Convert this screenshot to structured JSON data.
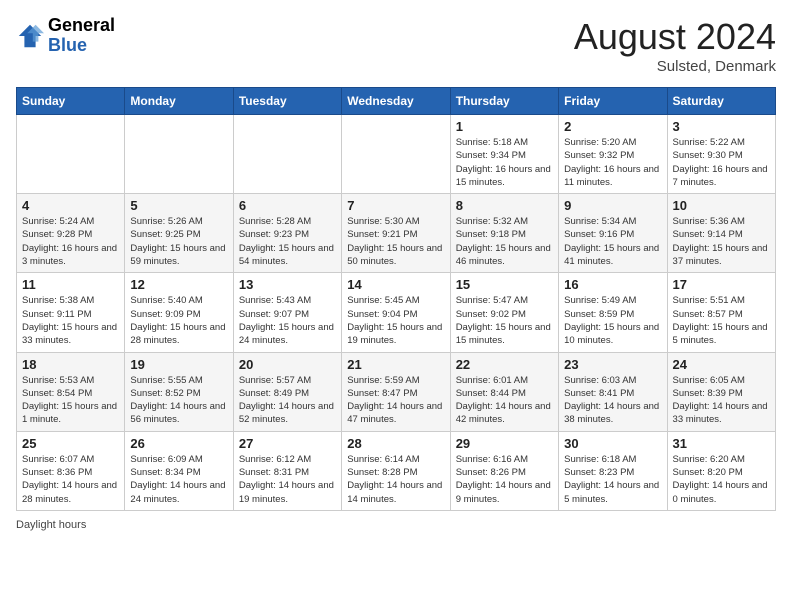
{
  "header": {
    "logo_general": "General",
    "logo_blue": "Blue",
    "month_title": "August 2024",
    "subtitle": "Sulsted, Denmark"
  },
  "days_of_week": [
    "Sunday",
    "Monday",
    "Tuesday",
    "Wednesday",
    "Thursday",
    "Friday",
    "Saturday"
  ],
  "weeks": [
    [
      {
        "day": "",
        "info": ""
      },
      {
        "day": "",
        "info": ""
      },
      {
        "day": "",
        "info": ""
      },
      {
        "day": "",
        "info": ""
      },
      {
        "day": "1",
        "info": "Sunrise: 5:18 AM\nSunset: 9:34 PM\nDaylight: 16 hours and 15 minutes."
      },
      {
        "day": "2",
        "info": "Sunrise: 5:20 AM\nSunset: 9:32 PM\nDaylight: 16 hours and 11 minutes."
      },
      {
        "day": "3",
        "info": "Sunrise: 5:22 AM\nSunset: 9:30 PM\nDaylight: 16 hours and 7 minutes."
      }
    ],
    [
      {
        "day": "4",
        "info": "Sunrise: 5:24 AM\nSunset: 9:28 PM\nDaylight: 16 hours and 3 minutes."
      },
      {
        "day": "5",
        "info": "Sunrise: 5:26 AM\nSunset: 9:25 PM\nDaylight: 15 hours and 59 minutes."
      },
      {
        "day": "6",
        "info": "Sunrise: 5:28 AM\nSunset: 9:23 PM\nDaylight: 15 hours and 54 minutes."
      },
      {
        "day": "7",
        "info": "Sunrise: 5:30 AM\nSunset: 9:21 PM\nDaylight: 15 hours and 50 minutes."
      },
      {
        "day": "8",
        "info": "Sunrise: 5:32 AM\nSunset: 9:18 PM\nDaylight: 15 hours and 46 minutes."
      },
      {
        "day": "9",
        "info": "Sunrise: 5:34 AM\nSunset: 9:16 PM\nDaylight: 15 hours and 41 minutes."
      },
      {
        "day": "10",
        "info": "Sunrise: 5:36 AM\nSunset: 9:14 PM\nDaylight: 15 hours and 37 minutes."
      }
    ],
    [
      {
        "day": "11",
        "info": "Sunrise: 5:38 AM\nSunset: 9:11 PM\nDaylight: 15 hours and 33 minutes."
      },
      {
        "day": "12",
        "info": "Sunrise: 5:40 AM\nSunset: 9:09 PM\nDaylight: 15 hours and 28 minutes."
      },
      {
        "day": "13",
        "info": "Sunrise: 5:43 AM\nSunset: 9:07 PM\nDaylight: 15 hours and 24 minutes."
      },
      {
        "day": "14",
        "info": "Sunrise: 5:45 AM\nSunset: 9:04 PM\nDaylight: 15 hours and 19 minutes."
      },
      {
        "day": "15",
        "info": "Sunrise: 5:47 AM\nSunset: 9:02 PM\nDaylight: 15 hours and 15 minutes."
      },
      {
        "day": "16",
        "info": "Sunrise: 5:49 AM\nSunset: 8:59 PM\nDaylight: 15 hours and 10 minutes."
      },
      {
        "day": "17",
        "info": "Sunrise: 5:51 AM\nSunset: 8:57 PM\nDaylight: 15 hours and 5 minutes."
      }
    ],
    [
      {
        "day": "18",
        "info": "Sunrise: 5:53 AM\nSunset: 8:54 PM\nDaylight: 15 hours and 1 minute."
      },
      {
        "day": "19",
        "info": "Sunrise: 5:55 AM\nSunset: 8:52 PM\nDaylight: 14 hours and 56 minutes."
      },
      {
        "day": "20",
        "info": "Sunrise: 5:57 AM\nSunset: 8:49 PM\nDaylight: 14 hours and 52 minutes."
      },
      {
        "day": "21",
        "info": "Sunrise: 5:59 AM\nSunset: 8:47 PM\nDaylight: 14 hours and 47 minutes."
      },
      {
        "day": "22",
        "info": "Sunrise: 6:01 AM\nSunset: 8:44 PM\nDaylight: 14 hours and 42 minutes."
      },
      {
        "day": "23",
        "info": "Sunrise: 6:03 AM\nSunset: 8:41 PM\nDaylight: 14 hours and 38 minutes."
      },
      {
        "day": "24",
        "info": "Sunrise: 6:05 AM\nSunset: 8:39 PM\nDaylight: 14 hours and 33 minutes."
      }
    ],
    [
      {
        "day": "25",
        "info": "Sunrise: 6:07 AM\nSunset: 8:36 PM\nDaylight: 14 hours and 28 minutes."
      },
      {
        "day": "26",
        "info": "Sunrise: 6:09 AM\nSunset: 8:34 PM\nDaylight: 14 hours and 24 minutes."
      },
      {
        "day": "27",
        "info": "Sunrise: 6:12 AM\nSunset: 8:31 PM\nDaylight: 14 hours and 19 minutes."
      },
      {
        "day": "28",
        "info": "Sunrise: 6:14 AM\nSunset: 8:28 PM\nDaylight: 14 hours and 14 minutes."
      },
      {
        "day": "29",
        "info": "Sunrise: 6:16 AM\nSunset: 8:26 PM\nDaylight: 14 hours and 9 minutes."
      },
      {
        "day": "30",
        "info": "Sunrise: 6:18 AM\nSunset: 8:23 PM\nDaylight: 14 hours and 5 minutes."
      },
      {
        "day": "31",
        "info": "Sunrise: 6:20 AM\nSunset: 8:20 PM\nDaylight: 14 hours and 0 minutes."
      }
    ]
  ],
  "footer": "Daylight hours"
}
